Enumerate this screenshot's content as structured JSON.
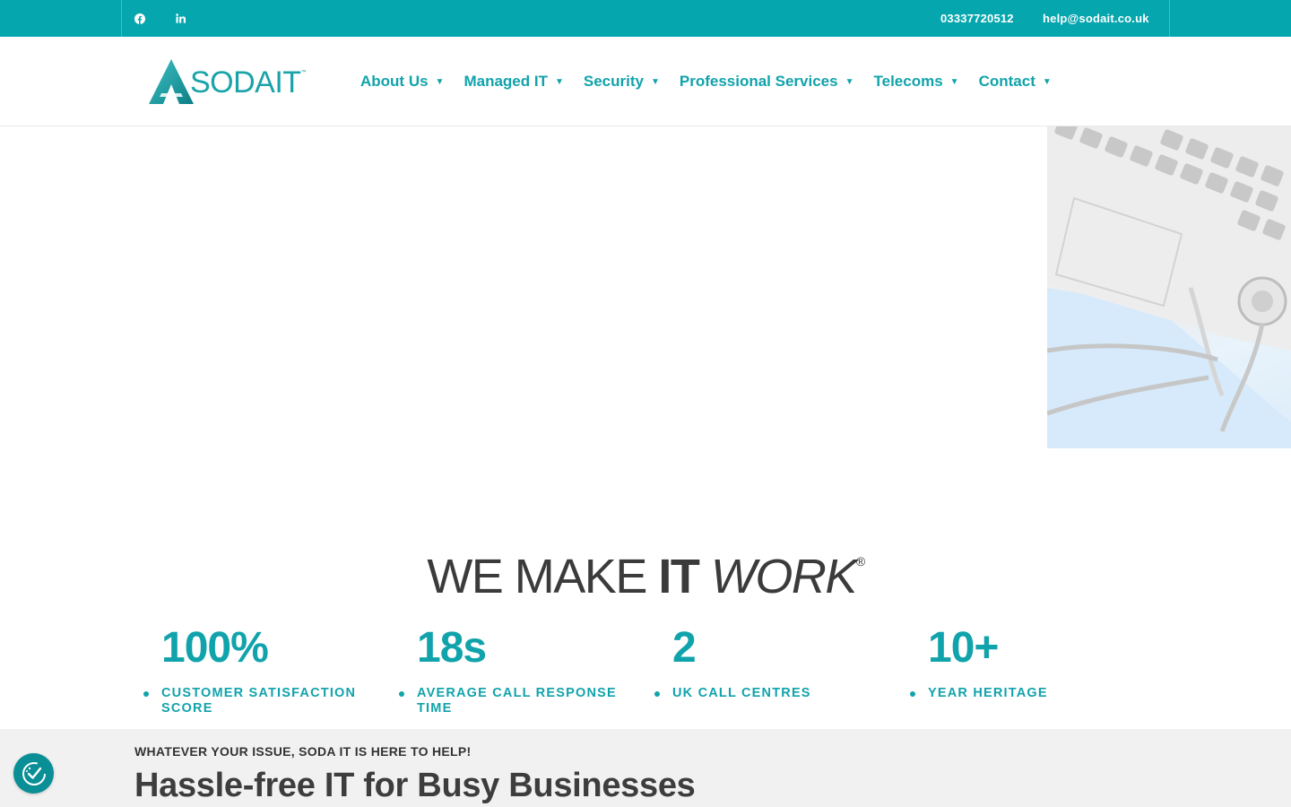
{
  "topbar": {
    "phone": "03337720512",
    "email": "help@sodait.co.uk",
    "social": [
      {
        "name": "facebook-icon"
      },
      {
        "name": "linkedin-icon"
      }
    ]
  },
  "logo": {
    "text": "SODAIT",
    "tm": "™"
  },
  "nav": {
    "items": [
      {
        "label": "About Us"
      },
      {
        "label": "Managed IT"
      },
      {
        "label": "Security"
      },
      {
        "label": "Professional Services"
      },
      {
        "label": "Telecoms"
      },
      {
        "label": "Contact"
      }
    ],
    "caret": "▼"
  },
  "tagline": {
    "part1": "WE MAKE ",
    "part2": "IT",
    "part3": " WORK",
    "reg": "®"
  },
  "stats": [
    {
      "value": "100%",
      "label": "Customer Satisfaction Score"
    },
    {
      "value": "18s",
      "label": "Average Call Response Time"
    },
    {
      "value": "2",
      "label": "UK Call Centres"
    },
    {
      "value": "10+",
      "label": "Year Heritage"
    }
  ],
  "strip": {
    "kicker": "WHATEVER YOUR ISSUE, SODA IT IS HERE TO HELP!",
    "title": "Hassle-free IT for Busy Businesses"
  },
  "colors": {
    "brand": "#05a6ae",
    "accent_text": "#11a3ab",
    "dark_text": "#3b3b3b"
  }
}
